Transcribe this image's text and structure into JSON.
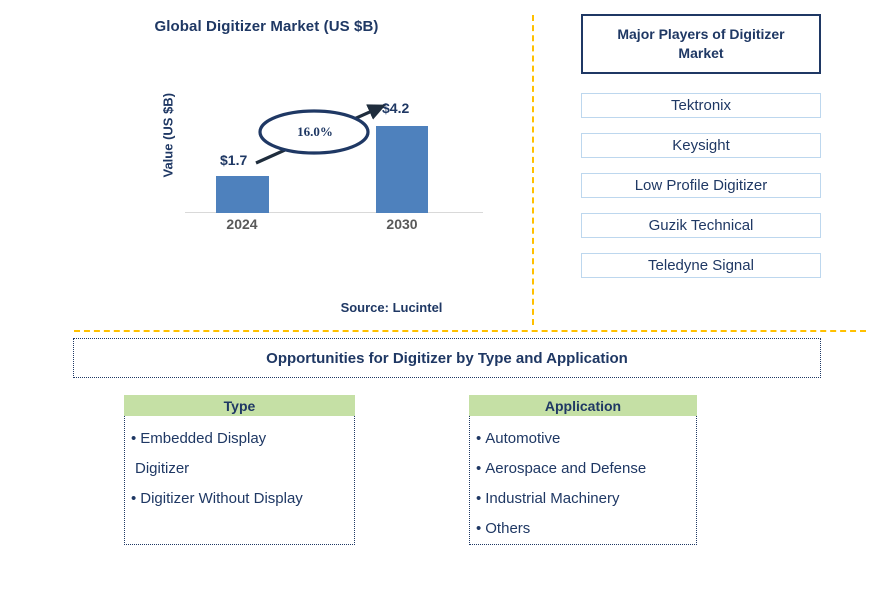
{
  "chart_data": {
    "type": "bar",
    "title": "Global Digitizer Market (US $B)",
    "ylabel": "Value (US $B)",
    "xlabel": "",
    "categories": [
      "2024",
      "2030"
    ],
    "values": [
      1.7,
      4.2
    ],
    "value_labels": [
      "$1.7",
      "$4.2"
    ],
    "cagr_label": "16.0%",
    "bar_color": "#4E81BD",
    "ylim": [
      0,
      4.2
    ],
    "grid": false,
    "legend": false,
    "source": "Source: Lucintel"
  },
  "chart": {
    "title": "Global Digitizer Market (US $B)",
    "y_axis_title": "Value (US $B)",
    "bars": [
      {
        "category": "2024",
        "value_label": "$1.7"
      },
      {
        "category": "2030",
        "value_label": "$4.2"
      }
    ],
    "cagr": "16.0%",
    "source": "Source: Lucintel"
  },
  "players": {
    "header": "Major Players of Digitizer Market",
    "items": [
      {
        "label": "Tektronix"
      },
      {
        "label": "Keysight"
      },
      {
        "label": "Low Profile Digitizer"
      },
      {
        "label": "Guzik Technical"
      },
      {
        "label": "Teledyne Signal"
      }
    ]
  },
  "opportunities": {
    "banner": "Opportunities for Digitizer by Type and Application",
    "columns": [
      {
        "header": "Type",
        "items": [
          "Embedded Display",
          "Digitizer",
          "Digitizer Without Display"
        ],
        "rendered_items": [
          {
            "bullet": "•",
            "text": "Embedded Display"
          },
          {
            "bullet": "",
            "text": "Digitizer"
          },
          {
            "bullet": "•",
            "text": "Digitizer Without Display"
          }
        ]
      },
      {
        "header": "Application",
        "items": [
          "Automotive",
          "Aerospace and Defense",
          "Industrial Machinery",
          "Others"
        ],
        "rendered_items": [
          {
            "bullet": "•",
            "text": "Automotive"
          },
          {
            "bullet": "•",
            "text": "Aerospace and Defense"
          },
          {
            "bullet": "•",
            "text": "Industrial Machinery"
          },
          {
            "bullet": "•",
            "text": "Others"
          }
        ]
      }
    ]
  },
  "colors": {
    "navy": "#1F3864",
    "bar_blue": "#4E81BD",
    "green_header": "#C5E0A5",
    "gold_divider": "#FFC000",
    "light_blue_border": "#BDD7EE"
  }
}
